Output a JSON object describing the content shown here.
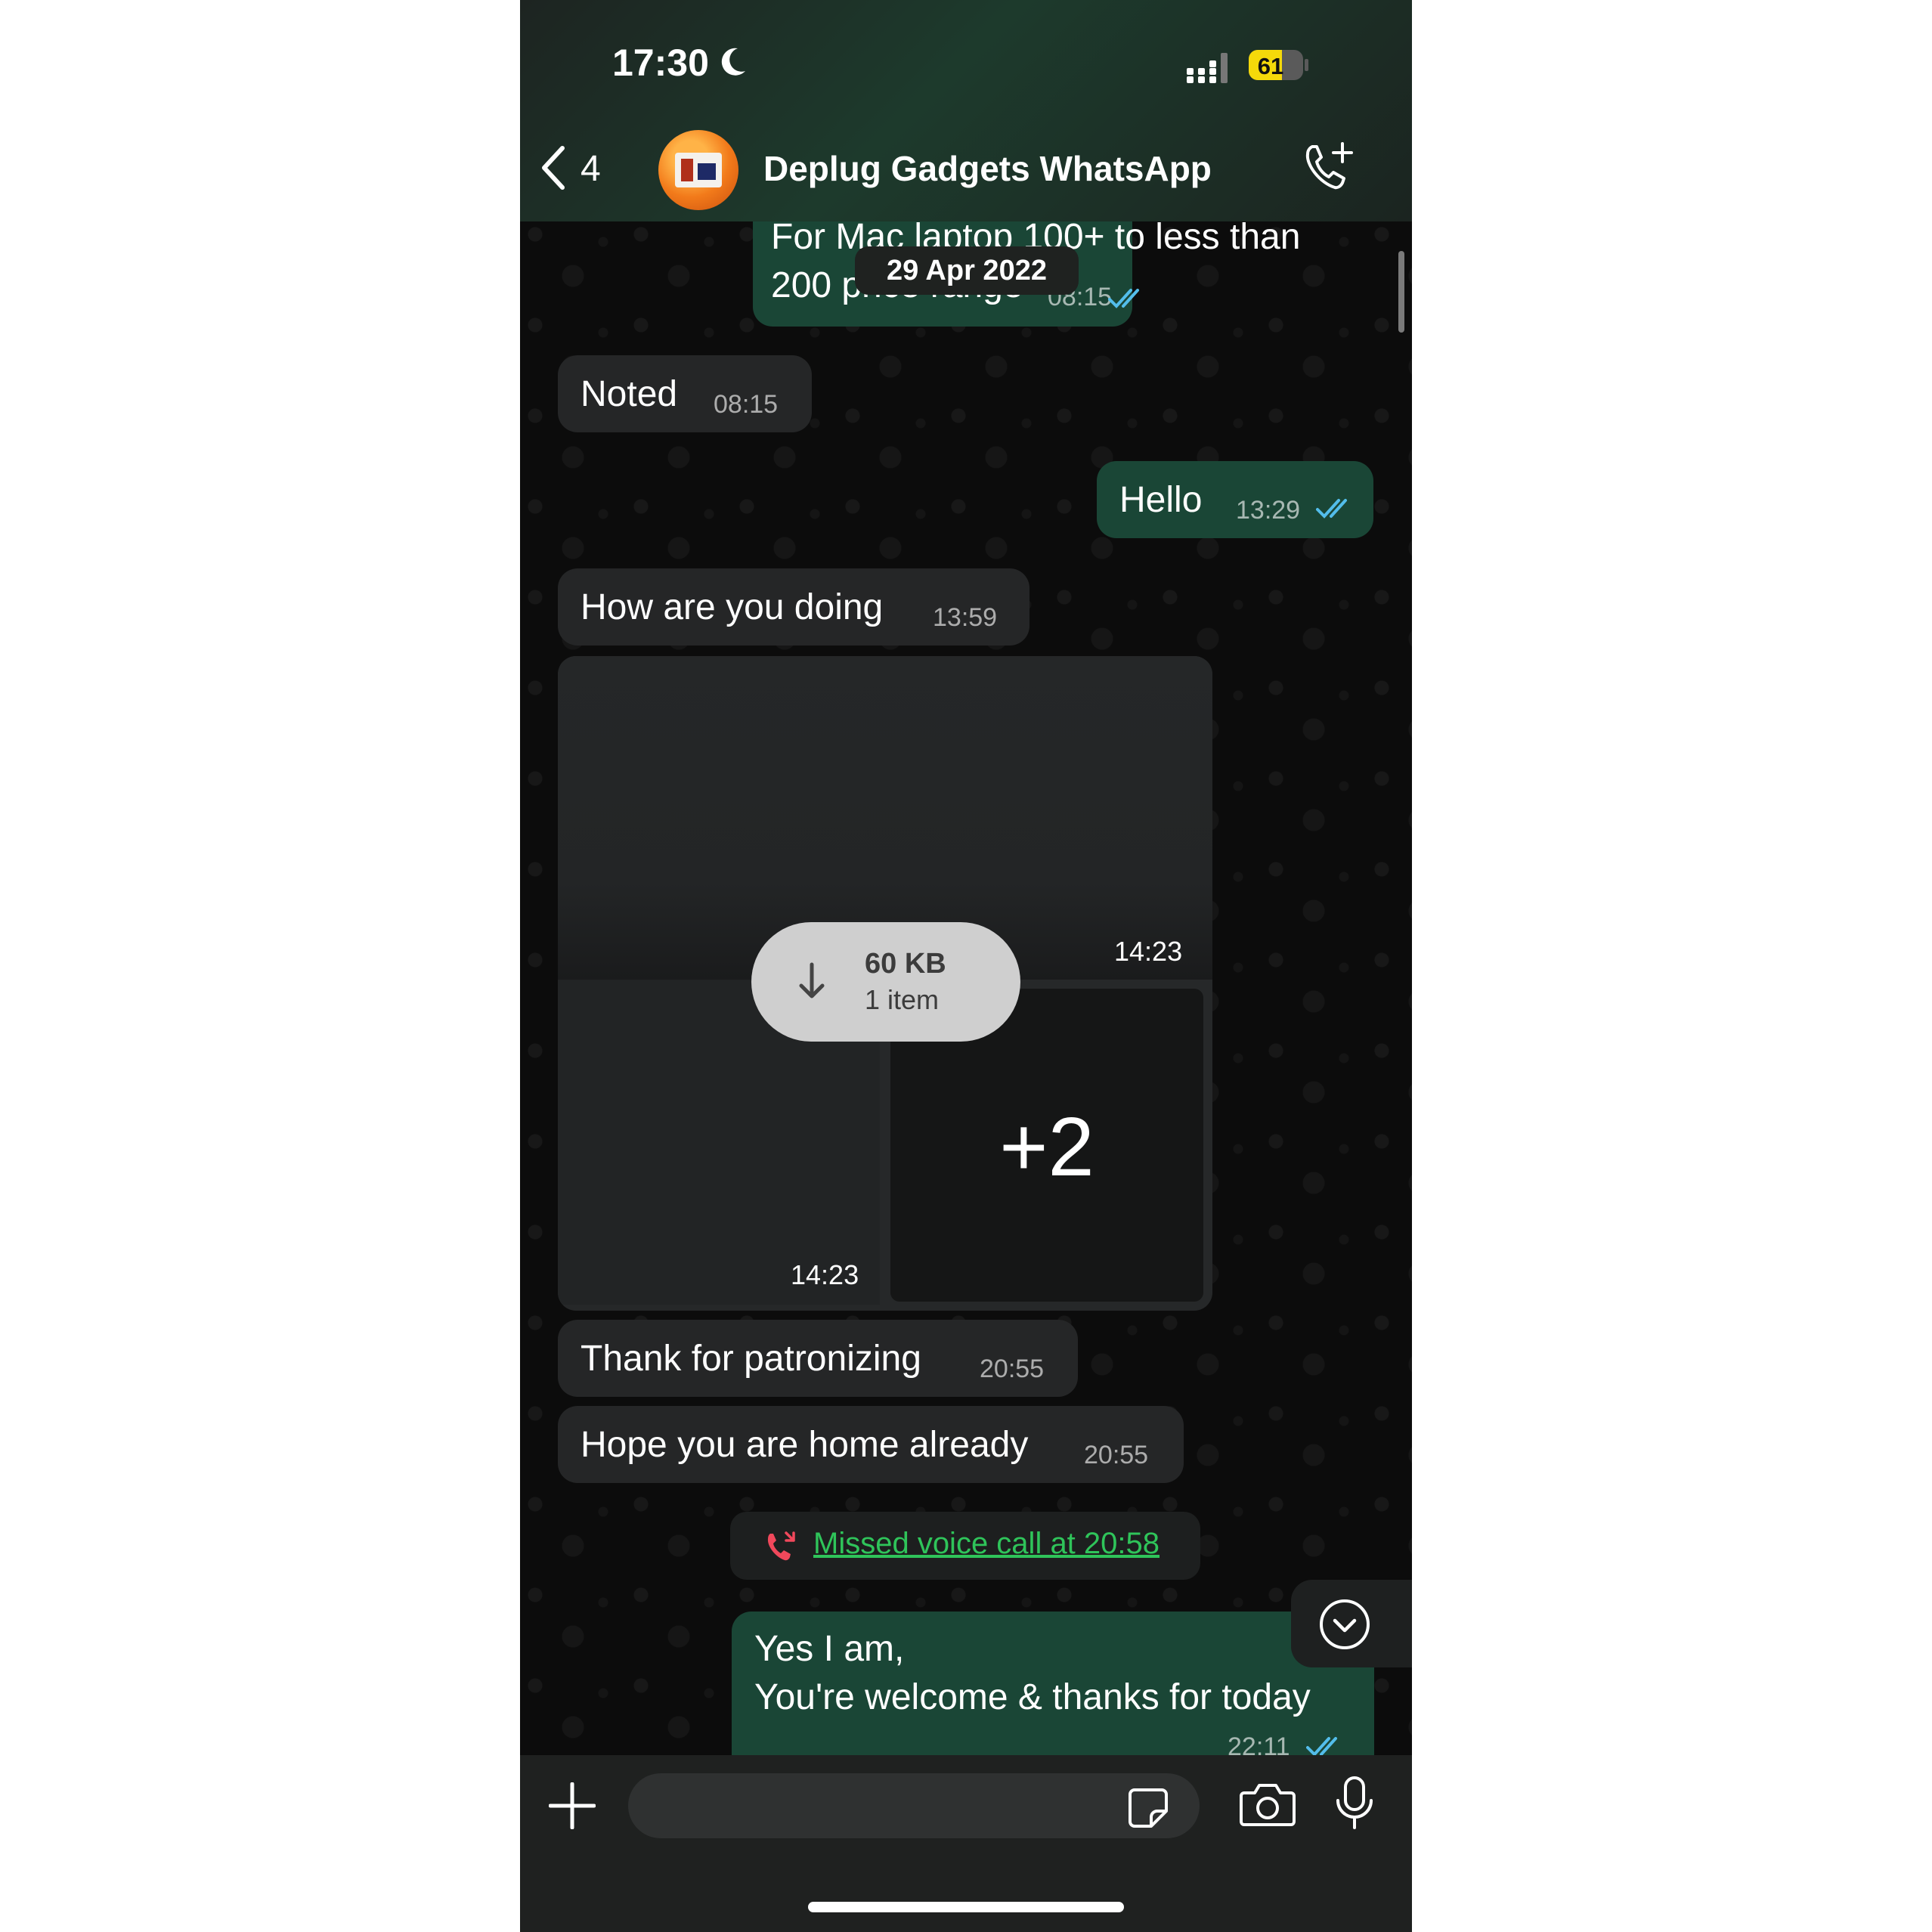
{
  "status_bar": {
    "time": "17:30",
    "battery_level": "61"
  },
  "header": {
    "back_count": "4",
    "chat_name": "Deplug Gadgets WhatsApp"
  },
  "date_label": "29 Apr 2022",
  "messages": [
    {
      "direction": "out",
      "text_line1": "For Mac laptop 100+ to less than",
      "text_line2": "200 price range",
      "time": "08:15"
    },
    {
      "direction": "in",
      "text": "Noted",
      "time": "08:15"
    },
    {
      "direction": "out",
      "text": "Hello",
      "time": "13:29"
    },
    {
      "direction": "in",
      "text": "How are you doing",
      "time": "13:59"
    },
    {
      "direction": "in",
      "text": "Thank for patronizing",
      "time": "20:55"
    },
    {
      "direction": "in",
      "text": "Hope you are home already",
      "time": "20:55"
    },
    {
      "direction": "out",
      "text_line1": "Yes I am,",
      "text_line2": "You're welcome & thanks for today",
      "time": "22:11"
    }
  ],
  "album": {
    "top_time": "14:23",
    "bottom_time": "14:23",
    "more_count": "+2",
    "download_size": "60 KB",
    "download_items": "1 item"
  },
  "missed_call": {
    "text": "Missed voice call at 20:58"
  },
  "colors": {
    "outgoing_bubble": "#1a4636",
    "incoming_bubble": "#252627",
    "read_ticks": "#53bdeb",
    "missed_call_green": "#2fc45a",
    "missed_call_icon": "#f0485b",
    "battery_yellow": "#f5d90a"
  },
  "icons": [
    "moon-icon",
    "signal-icon",
    "battery-icon",
    "back-chevron-icon",
    "add-call-icon",
    "double-check-icon",
    "download-arrow-icon",
    "missed-call-icon",
    "chevron-down-icon",
    "plus-icon",
    "sticker-icon",
    "camera-icon",
    "microphone-icon"
  ]
}
